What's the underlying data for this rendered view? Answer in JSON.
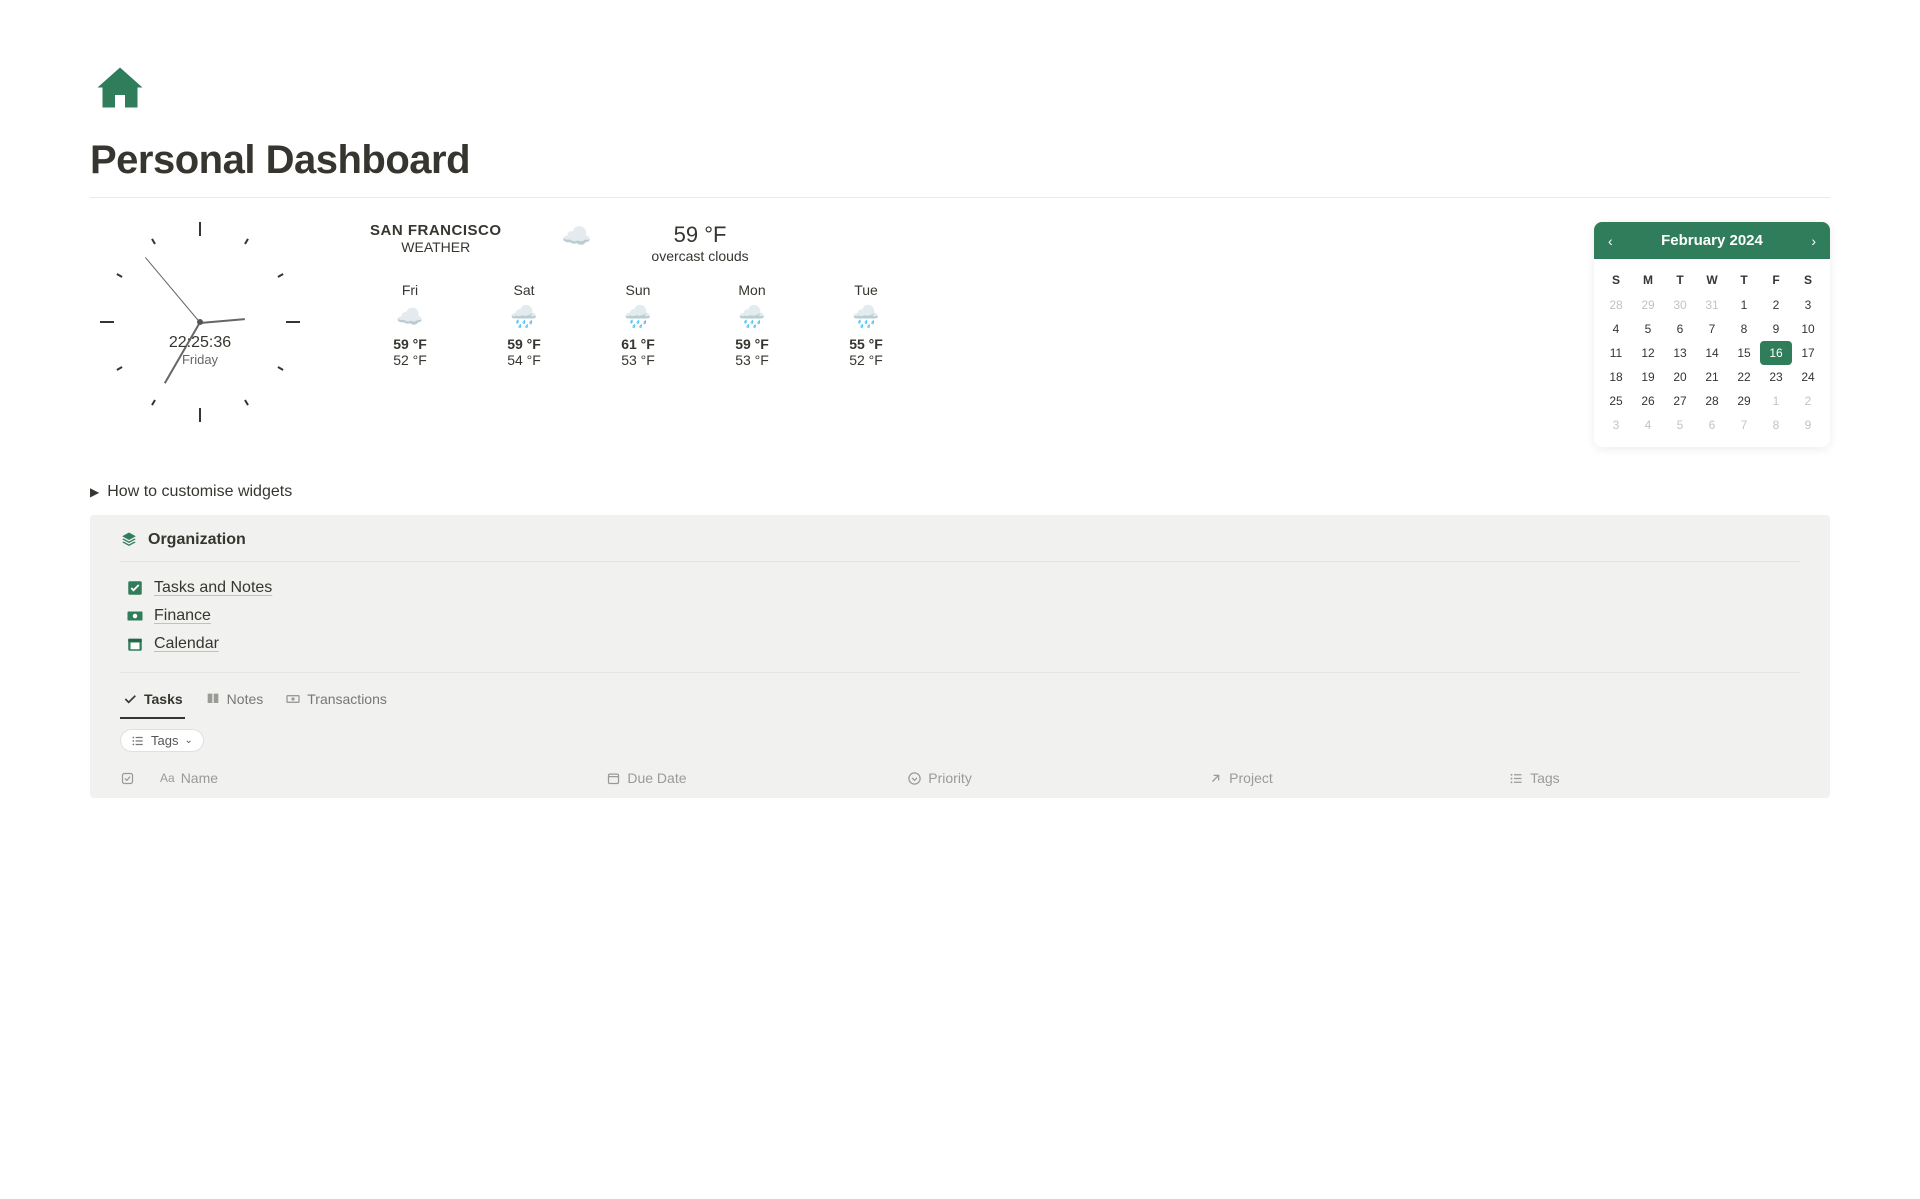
{
  "page": {
    "title": "Personal Dashboard"
  },
  "clock": {
    "time": "22:25:36",
    "day": "Friday"
  },
  "weather": {
    "city": "SAN FRANCISCO",
    "label": "WEATHER",
    "now_temp": "59 °F",
    "now_desc": "overcast clouds",
    "forecast": {
      "d0": {
        "name": "Fri",
        "hi": "59 °F",
        "lo": "52 °F"
      },
      "d1": {
        "name": "Sat",
        "hi": "59 °F",
        "lo": "54 °F"
      },
      "d2": {
        "name": "Sun",
        "hi": "61 °F",
        "lo": "53 °F"
      },
      "d3": {
        "name": "Mon",
        "hi": "59 °F",
        "lo": "53 °F"
      },
      "d4": {
        "name": "Tue",
        "hi": "55 °F",
        "lo": "52 °F"
      }
    }
  },
  "calendar": {
    "month": "February 2024",
    "dow": {
      "c0": "S",
      "c1": "M",
      "c2": "T",
      "c3": "W",
      "c4": "T",
      "c5": "F",
      "c6": "S"
    },
    "prev_trail": {
      "p0": "28",
      "p1": "29",
      "p2": "30",
      "p3": "31"
    },
    "days": {
      "d1": "1",
      "d2": "2",
      "d3": "3",
      "d4": "4",
      "d5": "5",
      "d6": "6",
      "d7": "7",
      "d8": "8",
      "d9": "9",
      "d10": "10",
      "d11": "11",
      "d12": "12",
      "d13": "13",
      "d14": "14",
      "d15": "15",
      "d16": "16",
      "d17": "17",
      "d18": "18",
      "d19": "19",
      "d20": "20",
      "d21": "21",
      "d22": "22",
      "d23": "23",
      "d24": "24",
      "d25": "25",
      "d26": "26",
      "d27": "27",
      "d28": "28",
      "d29": "29"
    },
    "next_trail": {
      "n0": "1",
      "n1": "2",
      "n2": "3",
      "n3": "4",
      "n4": "5",
      "n5": "6",
      "n6": "7",
      "n7": "8",
      "n8": "9"
    },
    "today": "16"
  },
  "expand": {
    "label": "How to customise widgets"
  },
  "org": {
    "title": "Organization",
    "links": {
      "l0": "Tasks and Notes",
      "l1": "Finance",
      "l2": "Calendar"
    },
    "tabs": {
      "t0": "Tasks",
      "t1": "Notes",
      "t2": "Transactions"
    },
    "tags_chip": "Tags",
    "columns": {
      "c0": "Name",
      "c1": "Due Date",
      "c2": "Priority",
      "c3": "Project",
      "c4": "Tags"
    }
  },
  "colors": {
    "accent": "#2f7d5b"
  }
}
